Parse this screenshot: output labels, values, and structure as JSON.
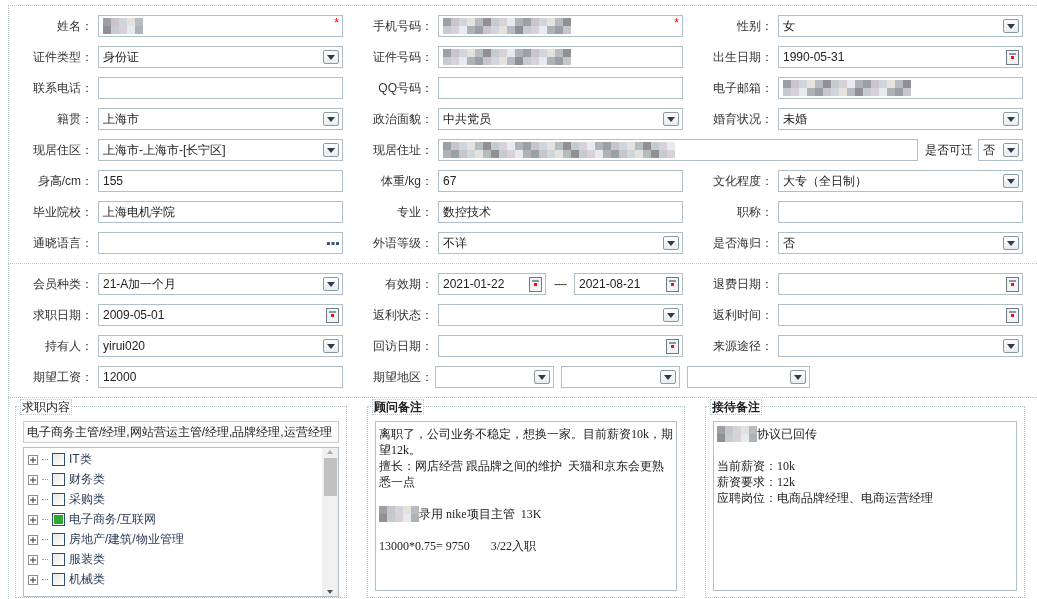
{
  "section_1": {
    "rows": [
      {
        "cells": [
          {
            "label": "姓名：",
            "kind": "text",
            "redacted": true,
            "required_mark": "*"
          },
          {
            "label": "手机号码：",
            "kind": "text",
            "redacted": true,
            "required_mark": "*"
          },
          {
            "label": "性别：",
            "kind": "select",
            "value": "女"
          }
        ]
      },
      {
        "cells": [
          {
            "label": "证件类型：",
            "kind": "select",
            "value": "身份证"
          },
          {
            "label": "证件号码：",
            "kind": "text",
            "redacted": true
          },
          {
            "label": "出生日期：",
            "kind": "date",
            "value": "1990-05-31"
          }
        ]
      },
      {
        "cells": [
          {
            "label": "联系电话：",
            "kind": "text"
          },
          {
            "label": "QQ号码：",
            "kind": "text"
          },
          {
            "label": "电子邮箱：",
            "kind": "text",
            "redacted": true
          }
        ]
      },
      {
        "cells": [
          {
            "label": "籍贯：",
            "kind": "select",
            "value": "上海市"
          },
          {
            "label": "政治面貌：",
            "kind": "select",
            "value": "中共党员"
          },
          {
            "label": "婚育状况：",
            "kind": "select",
            "value": "未婚"
          }
        ]
      },
      {
        "cells": [
          {
            "label": "现居住区：",
            "kind": "select",
            "value": "上海市-上海市-[长宁区]"
          },
          {
            "label": "现居住址：",
            "kind": "wide_text",
            "redacted": true,
            "option": {
              "label": "是否可迁",
              "value": "否"
            }
          }
        ]
      },
      {
        "cells": [
          {
            "label": "身高/cm：",
            "kind": "text",
            "value": "155"
          },
          {
            "label": "体重/kg：",
            "kind": "text",
            "value": "67"
          },
          {
            "label": "文化程度：",
            "kind": "select",
            "value": "大专（全日制）"
          }
        ]
      },
      {
        "cells": [
          {
            "label": "毕业院校：",
            "kind": "text",
            "value": "上海电机学院"
          },
          {
            "label": "专业：",
            "kind": "text",
            "value": "数控技术"
          },
          {
            "label": "职称：",
            "kind": "text"
          }
        ]
      },
      {
        "cells": [
          {
            "label": "通晓语言：",
            "kind": "picker"
          },
          {
            "label": "外语等级：",
            "kind": "select",
            "value": "不详"
          },
          {
            "label": "是否海归：",
            "kind": "select",
            "value": "否"
          }
        ]
      }
    ]
  },
  "section_2": {
    "rows": [
      {
        "cells": [
          {
            "label": "会员种类：",
            "kind": "select",
            "value": "21-A加一个月"
          },
          {
            "label": "有效期：",
            "kind": "date_range",
            "values": [
              "2021-01-22",
              "2021-08-21"
            ],
            "separator": "----"
          },
          {
            "label": "退费日期：",
            "kind": "date"
          }
        ]
      },
      {
        "cells": [
          {
            "label": "求职日期：",
            "kind": "date",
            "value": "2009-05-01"
          },
          {
            "label": "返利状态：",
            "kind": "select"
          },
          {
            "label": "返利时间：",
            "kind": "date"
          }
        ]
      },
      {
        "cells": [
          {
            "label": "持有人：",
            "kind": "select",
            "value": "yirui020"
          },
          {
            "label": "回访日期：",
            "kind": "date"
          },
          {
            "label": "来源途径：",
            "kind": "select"
          }
        ]
      },
      {
        "cells": [
          {
            "label": "期望工资：",
            "kind": "text",
            "value": "12000"
          },
          {
            "label": "期望地区：",
            "kind": "region_selects"
          }
        ]
      }
    ]
  },
  "job_intent": {
    "legend": "求职内容",
    "summary": "电子商务主管/经理,网站营运主管/经理,品牌经理,运营经理",
    "tree": [
      {
        "label": "IT类",
        "checked": false,
        "expanded": false
      },
      {
        "label": "财务类",
        "checked": false,
        "expanded": false
      },
      {
        "label": "采购类",
        "checked": false,
        "expanded": false
      },
      {
        "label": "电子商务/互联网",
        "checked": true,
        "expanded": false
      },
      {
        "label": "房地产/建筑/物业管理",
        "checked": false,
        "expanded": false
      },
      {
        "label": "服装类",
        "checked": false,
        "expanded": false
      },
      {
        "label": "机械类",
        "checked": false,
        "expanded": false
      }
    ]
  },
  "consultant_notes": {
    "legend": "顾问备注",
    "paragraphs": [
      [
        {
          "text": "离职了，公司业务不稳定，想换一家。目前薪资10k，期望12k。",
          "redacted": false
        },
        {
          "text": "擅长：网店经营 跟品牌之间的维护  天猫和京东会更熟悉一点",
          "redacted": false
        }
      ],
      [
        {
          "text": "录用 nike项目主管  13K",
          "redacted": true
        }
      ],
      [
        {
          "text": "13000*0.75= 9750       3/22入职",
          "redacted": false
        }
      ]
    ]
  },
  "reception_notes": {
    "legend": "接待备注",
    "paragraphs": [
      [
        {
          "text": "协议已回传",
          "redacted": true
        }
      ],
      [
        {
          "text": "当前薪资：10k",
          "redacted": false
        },
        {
          "text": "薪资要求：12k",
          "redacted": false
        },
        {
          "text": "应聘岗位：电商品牌经理、电商运营经理",
          "redacted": false
        }
      ]
    ]
  }
}
